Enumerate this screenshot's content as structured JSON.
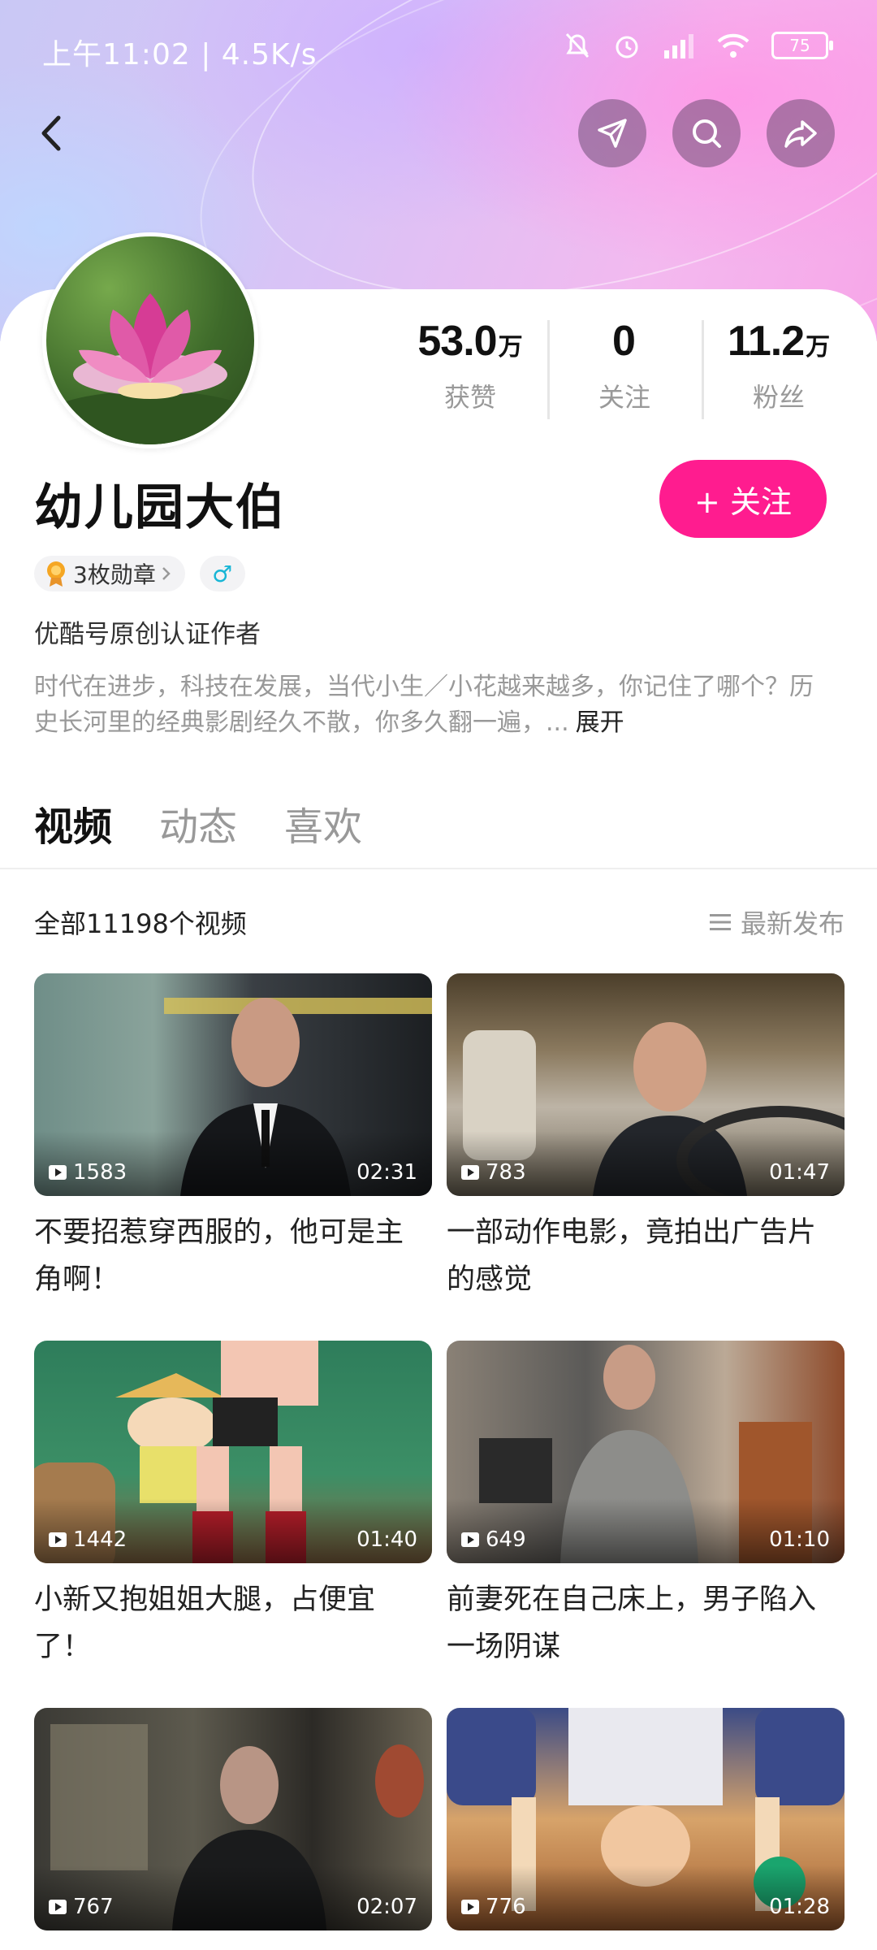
{
  "status_bar": {
    "text": "上午11:02 | 4.5K/s",
    "battery": "75"
  },
  "profile": {
    "stats": [
      {
        "value": "53.0",
        "unit": "万",
        "label": "获赞"
      },
      {
        "value": "0",
        "unit": "",
        "label": "关注"
      },
      {
        "value": "11.2",
        "unit": "万",
        "label": "粉丝"
      }
    ],
    "name": "幼儿园大伯",
    "follow_label": "+ 关注",
    "medals": "3枚勋章",
    "gender": "♂",
    "verified": "优酷号原创认证作者",
    "bio": "时代在进步，科技在发展，当代小生／小花越来越多，你记住了哪个？历史长河里的经典影剧经久不散，你多久翻一遍，...",
    "bio_expand": "展开"
  },
  "tabs": [
    "视频",
    "动态",
    "喜欢"
  ],
  "list": {
    "count_text": "全部11198个视频",
    "sort_label": "最新发布"
  },
  "videos": [
    {
      "views": "1583",
      "duration": "02:31",
      "title": "不要招惹穿西服的，他可是主角啊！"
    },
    {
      "views": "783",
      "duration": "01:47",
      "title": "一部动作电影，竟拍出广告片的感觉"
    },
    {
      "views": "1442",
      "duration": "01:40",
      "title": "小新又抱姐姐大腿，占便宜了！"
    },
    {
      "views": "649",
      "duration": "01:10",
      "title": "前妻死在自己床上，男子陷入一场阴谋"
    },
    {
      "views": "767",
      "duration": "02:07",
      "title": ""
    },
    {
      "views": "776",
      "duration": "01:28",
      "title": ""
    }
  ],
  "icons": [
    "back-icon",
    "send-icon",
    "search-icon",
    "share-icon",
    "medal-icon",
    "sort-list-icon",
    "play-icon"
  ]
}
